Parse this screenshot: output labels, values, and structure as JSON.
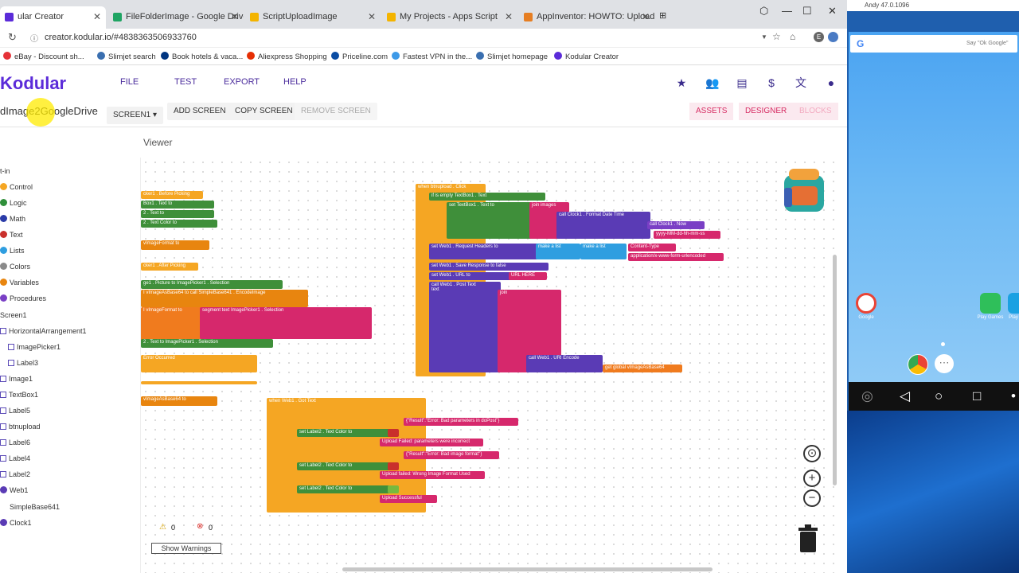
{
  "browser": {
    "tabs": [
      {
        "title": "ular Creator",
        "color": "#5b2bd9",
        "active": true
      },
      {
        "title": "FileFolderImage - Google Drive",
        "color": "#1fa463"
      },
      {
        "title": "ScriptUploadImage",
        "color": "#f4b400"
      },
      {
        "title": "My Projects - Apps Script",
        "color": "#f4b400"
      },
      {
        "title": "AppInventor: HOWTO: Upload Ima",
        "color": "#e67e22"
      }
    ],
    "url": "creator.kodular.io/#4838363506933760",
    "bookmarks": [
      {
        "label": "eBay - Discount sh...",
        "color": "#e53238"
      },
      {
        "label": "Slimjet search",
        "color": "#3a6fb0"
      },
      {
        "label": "Book hotels & vaca...",
        "color": "#003580"
      },
      {
        "label": "Aliexpress Shopping",
        "color": "#e62e04"
      },
      {
        "label": "Priceline.com",
        "color": "#0a4ca3"
      },
      {
        "label": "Fastest VPN in the...",
        "color": "#3d9ae8"
      },
      {
        "label": "Slimjet homepage",
        "color": "#3a6fb0"
      },
      {
        "label": "Kodular Creator",
        "color": "#5b2bd9"
      }
    ]
  },
  "app": {
    "logo": "Kodular",
    "menu": [
      "FILE",
      "TEST",
      "EXPORT",
      "HELP"
    ],
    "project_name": "dImage2GoogleDrive",
    "screen_select": "SCREEN1",
    "buttons": {
      "add_screen": "ADD SCREEN",
      "copy_screen": "COPY SCREEN",
      "remove_screen": "REMOVE SCREEN"
    },
    "right_buttons": {
      "assets": "ASSETS",
      "designer": "DESIGNER",
      "blocks": "BLOCKS"
    },
    "viewer_label": "Viewer",
    "accent": "#5b2bd9"
  },
  "sidebar": {
    "builtin_label": "t-in",
    "builtins": [
      {
        "label": "Control",
        "color": "#f5a623"
      },
      {
        "label": "Logic",
        "color": "#2f8f3a"
      },
      {
        "label": "Math",
        "color": "#2a3ba8"
      },
      {
        "label": "Text",
        "color": "#c9302c"
      },
      {
        "label": "Lists",
        "color": "#2f9ee0"
      },
      {
        "label": "Colors",
        "color": "#8a8a8a"
      },
      {
        "label": "Variables",
        "color": "#e8850f"
      },
      {
        "label": "Procedures",
        "color": "#7a3fc5"
      }
    ],
    "components": [
      "Screen1",
      "HorizontalArrangement1",
      "ImagePicker1",
      "Label3",
      "Image1",
      "TextBox1",
      "Label5",
      "btnupload",
      "Label6",
      "Label4",
      "Label2",
      "Web1",
      "SimpleBase641",
      "Clock1"
    ]
  },
  "blocks": {
    "before_picking": "cker1 . Before Picking",
    "after_picking": "cker1 . After Picking",
    "error_occurred": "Error Occurred",
    "when_btn": "when  btnupload . Click",
    "when_web": "when  Web1 . Got Text",
    "format_dt": "yyyy-MM-dd-hh-mm-ss",
    "content_type": "Content-Type",
    "content_val": "application/x-www-form-urlencoded",
    "url_here": "URL HERE",
    "err1": "{\"Result\":\"Error: Bad parameters in doPost\"}",
    "upload_fail1": "Upload Failed: parameters were incorrect",
    "err2": "{\"Result\":\"Error: Bad image format\"}",
    "upload_fail2": "Upload failed: Wrong Image Format Used",
    "upload_ok": "Upload Successful"
  },
  "warnings": {
    "warn_count": "0",
    "error_count": "0",
    "show_label": "Show Warnings"
  },
  "emulator": {
    "title": "Andy 47.0.1096",
    "search_hint": "Say \"Ok Google\"",
    "apps": [
      "Google",
      "Play Games",
      "Play"
    ]
  }
}
